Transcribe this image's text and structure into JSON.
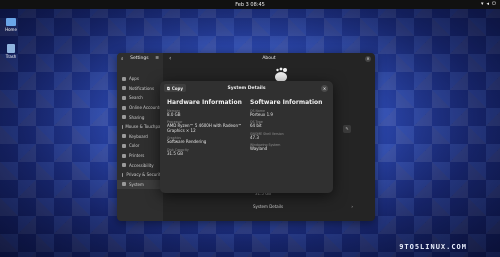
{
  "topbar": {
    "clock": "Feb 3  08:45",
    "tray_icons": [
      "network-icon",
      "volume-icon",
      "power-icon"
    ]
  },
  "desktop": {
    "icons": [
      {
        "label": "Home",
        "name": "home-folder-icon"
      },
      {
        "label": "Trash",
        "name": "trash-icon"
      }
    ]
  },
  "settings": {
    "title": "Settings",
    "page_title": "About",
    "sidebar_items": [
      "Apps",
      "Notifications",
      "Search",
      "Online Accounts",
      "Sharing",
      "Mouse & Touchpad",
      "Keyboard",
      "Color",
      "Printers",
      "Accessibility",
      "Privacy & Security",
      "System"
    ],
    "ram_text": "31.5 GB",
    "system_details_label": "System Details"
  },
  "dialog": {
    "title": "System Details",
    "copy_label": "Copy",
    "hardware": {
      "heading": "Hardware Information",
      "fields": [
        {
          "label": "Memory",
          "value": "8.0 GB"
        },
        {
          "label": "Processor",
          "value": "AMD Ryzen™ 5 4600H with Radeon™ Graphics × 12"
        },
        {
          "label": "Graphics",
          "value": "Software Rendering"
        },
        {
          "label": "Disk Capacity",
          "value": "31.5 GB"
        }
      ]
    },
    "software": {
      "heading": "Software Information",
      "fields": [
        {
          "label": "OS Name",
          "value": "Porteux 1.9"
        },
        {
          "label": "OS Type",
          "value": "64 bit"
        },
        {
          "label": "GNOME Shell Version",
          "value": "47.3"
        },
        {
          "label": "Windowing System",
          "value": "Wayland"
        }
      ]
    }
  },
  "watermark": "9TO5LINUX.COM"
}
